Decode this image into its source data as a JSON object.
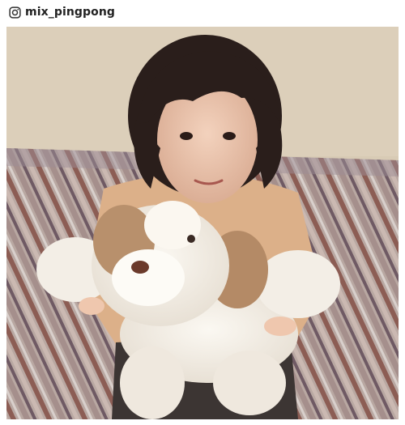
{
  "header": {
    "icon": "instagram-icon",
    "handle": "mix_pingpong"
  },
  "photo": {
    "subject": "photograph"
  }
}
